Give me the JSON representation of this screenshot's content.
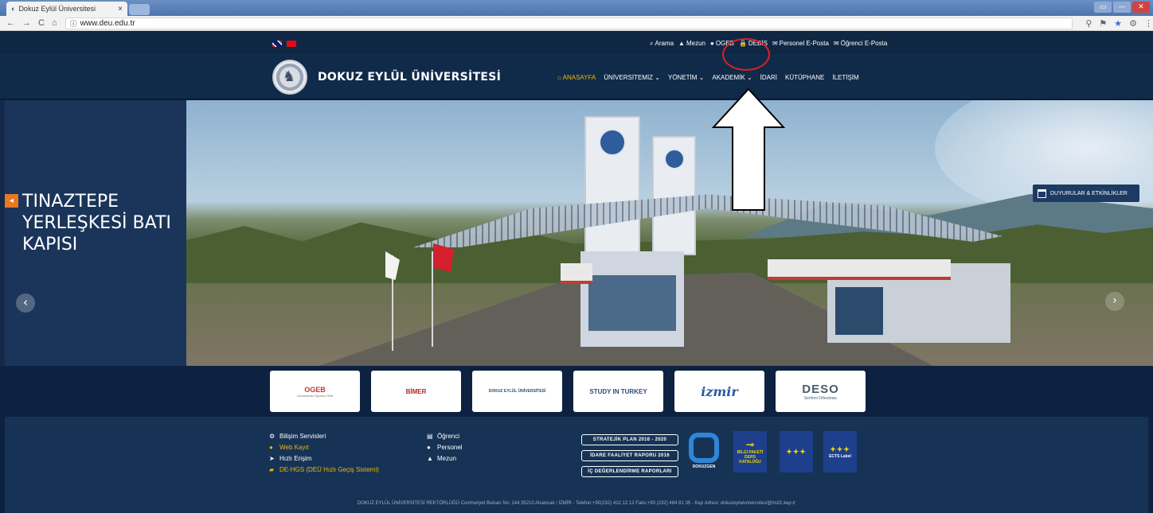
{
  "browser": {
    "tab_title": "Dokuz Eylül Üniversitesi",
    "tab_close": "×",
    "url": "www.deu.edu.tr",
    "nav_icons": [
      "←",
      "→",
      "C",
      "⌂"
    ],
    "right_icons": [
      "⚲",
      "⚑",
      "★",
      "⚙",
      "⋮"
    ],
    "window_controls": [
      "▭",
      "—",
      "✕"
    ]
  },
  "topbar": {
    "links": [
      {
        "icon": "search-icon",
        "glyph": "🔍",
        "label": "Arama"
      },
      {
        "icon": "graduation-cap-icon",
        "glyph": "🎓",
        "label": "Mezun"
      },
      {
        "icon": "comment-icon",
        "glyph": "💬",
        "label": "OGEB"
      },
      {
        "icon": "lock-icon",
        "glyph": "🔒",
        "label": "DEBİS"
      },
      {
        "icon": "envelope-icon",
        "glyph": "✉",
        "label": "Personel E-Posta"
      },
      {
        "icon": "envelope-icon",
        "glyph": "✉",
        "label": "Öğrenci E-Posta"
      }
    ]
  },
  "header": {
    "university_name": "DOKUZ EYLÜL ÜNİVERSİTESİ",
    "menu": [
      {
        "label": "ANASAYFA",
        "active": true,
        "icon": "🏛"
      },
      {
        "label": "ÜNİVERSİTEMİZ ⌄"
      },
      {
        "label": "YÖNETİM ⌄"
      },
      {
        "label": "AKADEMİK ⌄"
      },
      {
        "label": "İDARİ"
      },
      {
        "label": "KÜTÜPHANE"
      },
      {
        "label": "İLETİŞİM"
      }
    ]
  },
  "hero": {
    "slide_title": "TINAZTEPE YERLEŞKESİ BATI KAPISI",
    "prev_arrow": "‹",
    "next_arrow": "›",
    "badge_icon": "📢",
    "announcements_label": "DUYURULAR & ETKİNLİKLER"
  },
  "partners": [
    {
      "name": "OGEB",
      "sub": "Uluslararası Öğrenci Ofisi"
    },
    {
      "name": "BİMER",
      "sub": ""
    },
    {
      "name": "DOKUZ EYLÜL ÜNİVERSİTESİ",
      "sub": ""
    },
    {
      "name": "STUDY IN TURKEY",
      "sub": ""
    },
    {
      "name": "izmir",
      "sub": ""
    },
    {
      "name": "DESO",
      "sub": "Senfoni Orkestrası"
    }
  ],
  "footer": {
    "col1": [
      {
        "glyph": "⚙",
        "label": "Bilişim Servisleri",
        "gold": false
      },
      {
        "glyph": "👤",
        "label": "Web Kayıt",
        "gold": true
      },
      {
        "glyph": "➤",
        "label": "Hızlı Erişim",
        "gold": false
      },
      {
        "glyph": "🚗",
        "label": "DE-HGS (DEÜ Hızlı Geçiş Sistemi)",
        "gold": true
      }
    ],
    "col2": [
      {
        "glyph": "📖",
        "label": "Öğrenci"
      },
      {
        "glyph": "👥",
        "label": "Personel"
      },
      {
        "glyph": "🎓",
        "label": "Mezun"
      }
    ],
    "buttons": [
      "STRATEJİK PLAN 2016 - 2020",
      "İDARE FAALİYET RAPORU 2016",
      "İÇ DEĞERLENDİRME RAPORLARI"
    ],
    "dokuzgen": "DOKUZGEN",
    "badge1": {
      "line1": "BİLGİ PAKETİ",
      "line2": "DERS",
      "line3": "KATALOĞU"
    },
    "badge2": {
      "line1": "",
      "line2": ""
    },
    "badge3": {
      "line1": "ECTS Label"
    },
    "address": "DOKUZ EYLÜL ÜNİVERSİTESİ REKTÖRLÜĞÜ Cumhuriyet Bulvarı No: 144 35210 Alsancak / İZMİR - Telefon:+90(232) 412 12 12 Faks:+90 (232) 464 81 35 -",
    "kep": "Kep Adresi: dokuzeyluluniversitesi@hs01.kep.tr"
  },
  "colors": {
    "accent": "#f3b400",
    "navy": "#102a4a",
    "annotation": "#e02020"
  }
}
